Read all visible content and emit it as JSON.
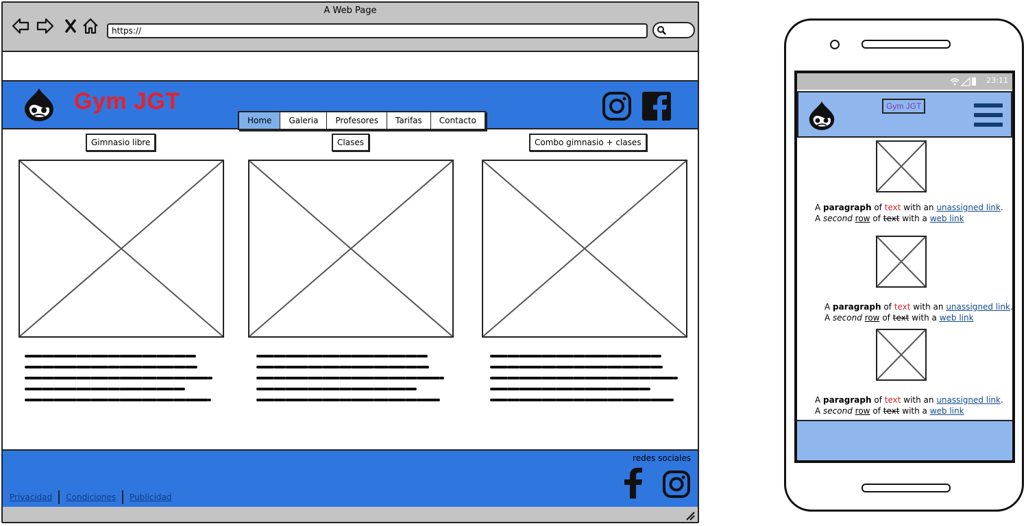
{
  "browser": {
    "window_title": "A Web Page",
    "url": "https://",
    "icons": [
      "back-arrow-icon",
      "forward-arrow-icon",
      "close-x-icon",
      "home-icon",
      "search-icon"
    ]
  },
  "site": {
    "title": "Gym JGT",
    "brand_color": "#2f77df",
    "title_color": "#e8202a",
    "nav": [
      {
        "label": "Home",
        "active": true
      },
      {
        "label": "Galeria"
      },
      {
        "label": "Profesores"
      },
      {
        "label": "Tarifas"
      },
      {
        "label": "Contacto"
      }
    ],
    "columns": [
      {
        "label": "Gimnasio libre"
      },
      {
        "label": "Clases"
      },
      {
        "label": "Combo gimnasio + clases"
      }
    ],
    "footer": {
      "social_label": "redes sociales",
      "links": [
        "Privacidad",
        "Condiciones",
        "Publicidad"
      ]
    }
  },
  "mobile": {
    "time": "23:11",
    "title": "Gym JGT",
    "paragraph": {
      "a": "A",
      "bold": "paragraph",
      "of": "of",
      "red": "text",
      "with_an": "with an",
      "link1": "unassigned link",
      "dot": ".",
      "second_a": "A",
      "second": "second",
      "row": "row",
      "of2": "of",
      "strike": "text",
      "with_a": "with a",
      "link2": "web link"
    }
  }
}
